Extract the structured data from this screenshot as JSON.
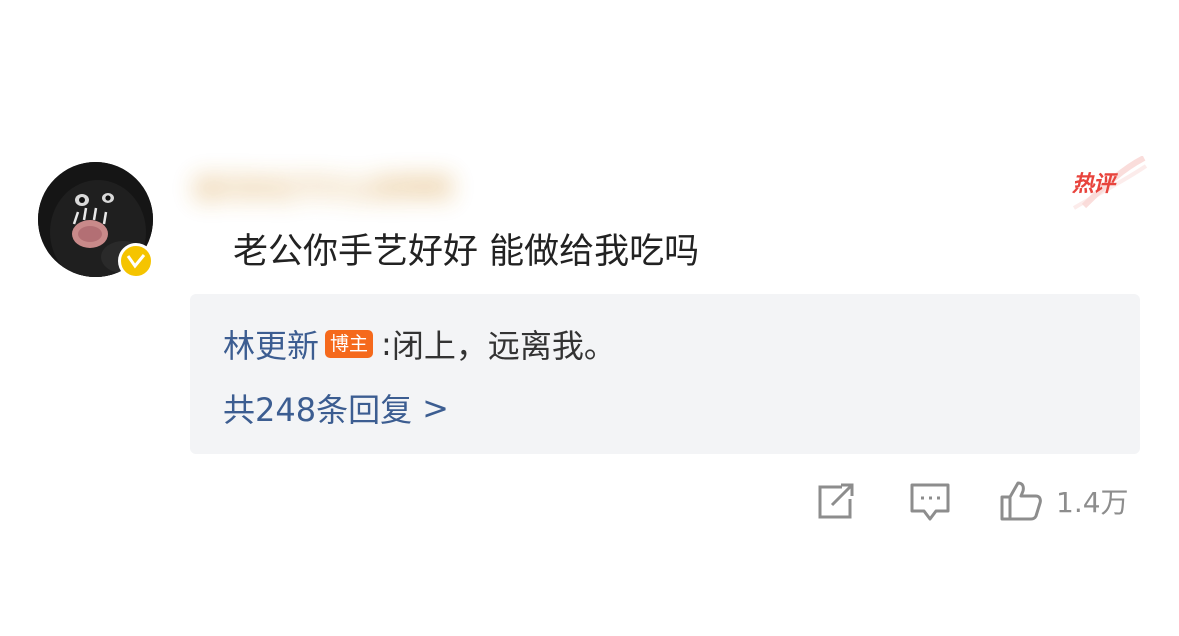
{
  "comment": {
    "username": "请问你在干什么呢啊啊",
    "content": "老公你手艺好好 能做给我吃吗",
    "hot_tag": "热评",
    "reply": {
      "author": "林更新",
      "author_badge": "博主",
      "colon": ":",
      "text": "闭上，远离我。"
    },
    "reply_count": {
      "label": "共248条回复",
      "chevron": ">"
    },
    "actions": {
      "share_icon": "share-icon",
      "comment_icon": "comment-icon",
      "like_icon": "thumbs-up-icon",
      "like_count": "1.4万"
    }
  },
  "watermark": "",
  "colors": {
    "link_blue": "#3c5d91",
    "hot_red": "#e8443d",
    "badge_orange": "#f5691c",
    "verified_yellow": "#f5c400",
    "reply_bg": "#f3f4f6",
    "icon_gray": "#8d8d8d"
  }
}
